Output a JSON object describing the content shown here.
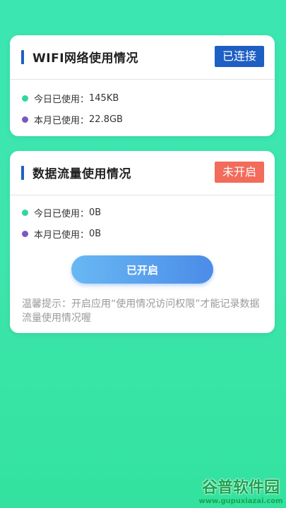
{
  "wifi_card": {
    "title": "WIFI网络使用情况",
    "status": "已连接",
    "today_label": "今日已使用：",
    "today_value": "145KB",
    "month_label": "本月已使用：",
    "month_value": "22.8GB"
  },
  "data_card": {
    "title": "数据流量使用情况",
    "status": "未开启",
    "today_label": "今日已使用：",
    "today_value": "0B",
    "month_label": "本月已使用：",
    "month_value": "0B",
    "button_label": "已开启",
    "tip": "温馨提示：开启应用“使用情况访问权限”才能记录数据流量使用情况喔"
  },
  "watermark": {
    "name": "谷普软件园",
    "url": "www.gupuxiazai.com"
  },
  "colors": {
    "accent": "#1d5fc7",
    "connected": "#1e5fc4",
    "disabled": "#f26b5b",
    "dot_today": "#2fd79c",
    "dot_month": "#7c57c3"
  }
}
